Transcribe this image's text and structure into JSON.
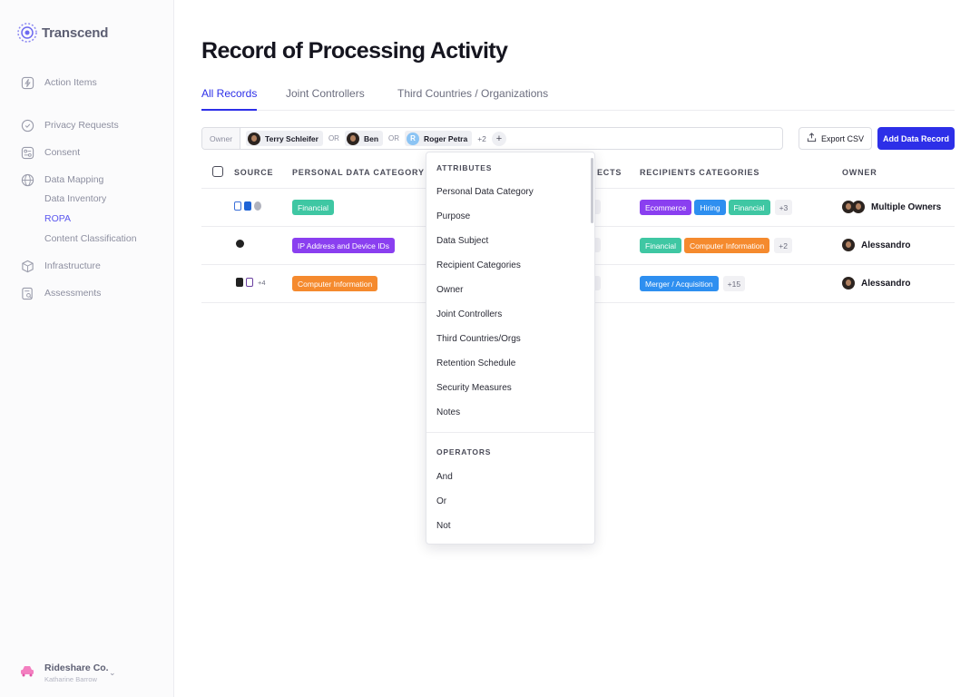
{
  "brand": {
    "name": "Transcend"
  },
  "sidebar": {
    "items": [
      {
        "label": "Action Items",
        "icon": "lightning-icon"
      },
      {
        "label": "Privacy Requests",
        "icon": "chat-check-icon"
      },
      {
        "label": "Consent",
        "icon": "toggle-icon"
      },
      {
        "label": "Data Mapping",
        "icon": "globe-icon"
      },
      {
        "label": "Infrastructure",
        "icon": "cube-icon"
      },
      {
        "label": "Assessments",
        "icon": "clipboard-search-icon"
      }
    ],
    "sub_items": [
      {
        "label": "Data Inventory",
        "active": false
      },
      {
        "label": "ROPA",
        "active": true
      },
      {
        "label": "Content Classification",
        "active": false
      }
    ],
    "org": {
      "name": "Rideshare Co.",
      "user": "Katharine Barrow"
    }
  },
  "page": {
    "title": "Record of Processing Activity"
  },
  "tabs": [
    {
      "label": "All Records",
      "active": true
    },
    {
      "label": "Joint Controllers",
      "active": false
    },
    {
      "label": "Third Countries / Organizations",
      "active": false
    }
  ],
  "filter": {
    "field": "Owner",
    "values": [
      {
        "name": "Terry Schleifer",
        "avatar": "photo"
      },
      {
        "name": "Ben",
        "avatar": "photo"
      },
      {
        "name": "Roger Petra",
        "avatar": "R"
      }
    ],
    "operator": "OR",
    "more": "+2",
    "add": "+"
  },
  "actions": {
    "export": "Export CSV",
    "add": "Add Data Record"
  },
  "table": {
    "headers": {
      "source": "SOURCE",
      "category": "PERSONAL DATA CATEGORY",
      "subjects_partial": "ECTS",
      "recipients": "RECIPIENTS CATEGORIES",
      "owner": "OWNER"
    },
    "rows": [
      {
        "sources_more": "",
        "categories": [
          {
            "label": "Financial",
            "color": "#3fc7a3"
          }
        ],
        "recipients": [
          {
            "label": "Ecommerce",
            "color": "#8a3ff0"
          },
          {
            "label": "Hiring",
            "color": "#2e8ff0"
          },
          {
            "label": "Financial",
            "color": "#3fc7a3"
          }
        ],
        "recipients_more": "+3",
        "owner": "Multiple Owners"
      },
      {
        "sources_more": "",
        "categories": [
          {
            "label": "IP Address and Device IDs",
            "color": "#8a3ff0"
          }
        ],
        "recipients": [
          {
            "label": "Financial",
            "color": "#3fc7a3"
          },
          {
            "label": "Computer Information",
            "color": "#f58a2e"
          }
        ],
        "recipients_more": "+2",
        "owner": "Alessandro"
      },
      {
        "sources_more": "+4",
        "categories": [
          {
            "label": "Computer Information",
            "color": "#f58a2e"
          }
        ],
        "recipients": [
          {
            "label": "Merger / Acquisition",
            "color": "#2e8ff0"
          }
        ],
        "recipients_more": "+15",
        "owner": "Alessandro"
      }
    ]
  },
  "dropdown": {
    "attributes_title": "ATTRIBUTES",
    "attributes": [
      "Personal Data Category",
      "Purpose",
      "Data Subject",
      "Recipient Categories",
      "Owner",
      "Joint Controllers",
      "Third Countries/Orgs",
      "Retention Schedule",
      "Security Measures",
      "Notes"
    ],
    "operators_title": "OPERATORS",
    "operators": [
      "And",
      "Or",
      "Not"
    ]
  }
}
